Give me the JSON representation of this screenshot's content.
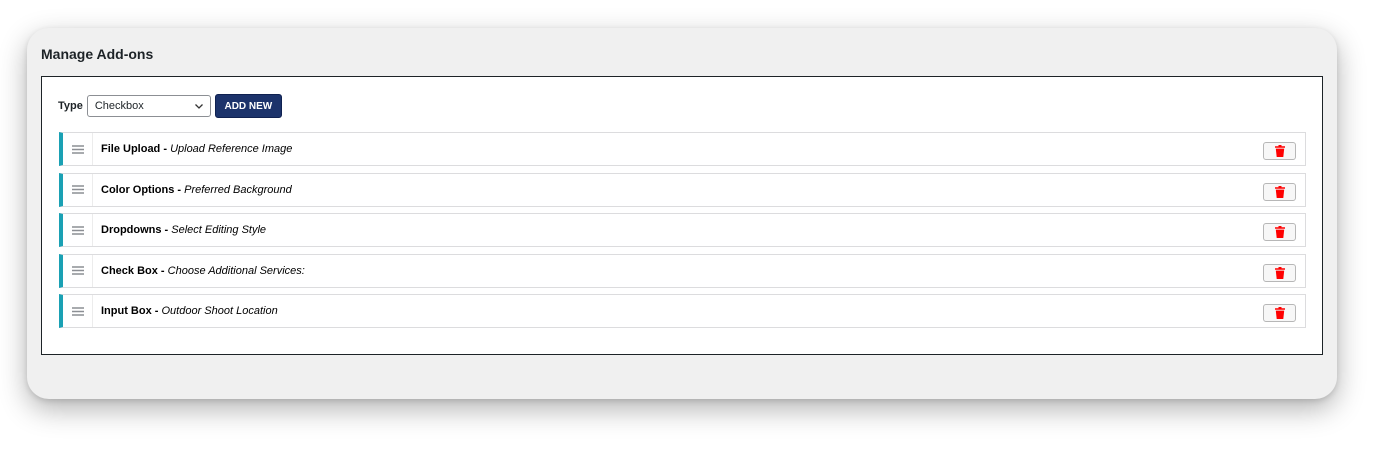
{
  "page": {
    "title": "Manage Add-ons"
  },
  "toolbar": {
    "type_label": "Type",
    "type_value": "Checkbox",
    "add_label": "ADD NEW"
  },
  "addons": [
    {
      "type": "File Upload",
      "separator": " - ",
      "name": "Upload Reference Image"
    },
    {
      "type": "Color Options",
      "separator": " - ",
      "name": "Preferred Background"
    },
    {
      "type": "Dropdowns",
      "separator": " - ",
      "name": "Select Editing Style"
    },
    {
      "type": "Check Box",
      "separator": " - ",
      "name": "Choose Additional Services:"
    },
    {
      "type": "Input Box",
      "separator": " - ",
      "name": "Outdoor Shoot Location"
    }
  ],
  "icons": {
    "drag": "drag-handle-icon",
    "delete": "trash-icon",
    "select_arrow": "chevron-down-icon"
  },
  "colors": {
    "accent": "#1aa1b4",
    "button_primary": "#1c336b",
    "delete": "#ff0000"
  }
}
